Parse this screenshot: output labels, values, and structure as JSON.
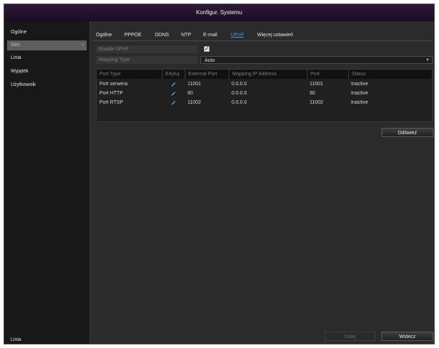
{
  "window": {
    "title": "Konfigur. Systemu"
  },
  "sidebar": {
    "items": [
      {
        "label": "Ogólne",
        "selected": false
      },
      {
        "label": "Sieć",
        "selected": true
      },
      {
        "label": "Linia",
        "selected": false
      },
      {
        "label": "Wyjątek",
        "selected": false
      },
      {
        "label": "Użytkownik",
        "selected": false
      }
    ],
    "bottom_label": "Linia"
  },
  "tabs": [
    {
      "label": "Ogólne",
      "active": false
    },
    {
      "label": "PPPOE",
      "active": false
    },
    {
      "label": "DDNS",
      "active": false
    },
    {
      "label": "NTP",
      "active": false
    },
    {
      "label": "E-mail",
      "active": false
    },
    {
      "label": "UPnP",
      "active": true
    },
    {
      "label": "Więcej ustawień",
      "active": false
    }
  ],
  "form": {
    "enable_upnp": {
      "label": "Enable UPnP",
      "checked": true,
      "mark": "✓"
    },
    "mapping_type": {
      "label": "Mapping Type",
      "value": "Auto"
    }
  },
  "table": {
    "headers": [
      "Port Type",
      "Edytuj",
      "External Port",
      "Mapping IP Address",
      "Port",
      "Status"
    ],
    "rows": [
      {
        "port_type": "Port serwera",
        "external_port": "11001",
        "mapping_ip": "0.0.0.0",
        "port": "11001",
        "status": "Inactive"
      },
      {
        "port_type": "Port HTTP",
        "external_port": "80",
        "mapping_ip": "0.0.0.0",
        "port": "80",
        "status": "Inactive"
      },
      {
        "port_type": "Port RTSP",
        "external_port": "11002",
        "mapping_ip": "0.0.0.0",
        "port": "11002",
        "status": "Inactive"
      }
    ]
  },
  "buttons": {
    "refresh": "Odśwież",
    "apply": "Dalej",
    "back": "Wstecz"
  },
  "colors": {
    "accent": "#4b8fd6",
    "titlebar": "#2d1838",
    "edit_icon": "#5aa0e0"
  },
  "icons": {
    "edit": "pencil-icon",
    "dropdown": "chevron-down-icon",
    "submenu": "chevron-right-icon"
  }
}
